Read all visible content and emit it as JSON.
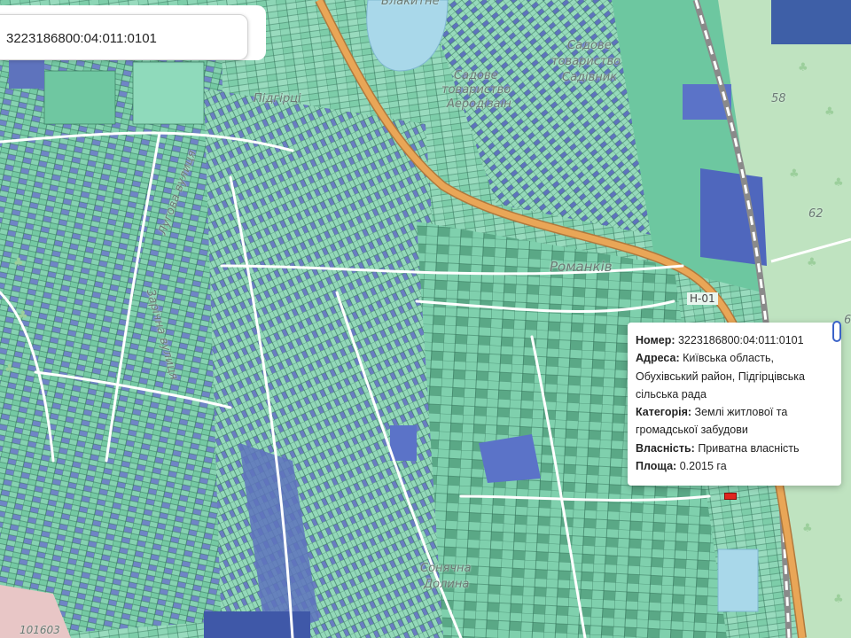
{
  "search": {
    "value": "3223186800:04:011:0101"
  },
  "map_labels": {
    "lake": "Блакитне",
    "garden_1": "Садове",
    "garden_2": "товариство",
    "garden_3": "Садівник",
    "garden_left_1": "Садове",
    "garden_left_2": "товариство",
    "garden_left_3": "Аеродізаін",
    "village": "Романків",
    "village_top": "Підгірці",
    "road_h01": "Н-01",
    "street_1": "Лугова вулиця",
    "street_2": "Зарічна вулиця",
    "sunny_1": "Сонячна",
    "sunny_2": "Долина",
    "num_58": "58",
    "num_62": "62",
    "num_6": "6",
    "bottom_code": "101603"
  },
  "popup": {
    "number_label": "Номер:",
    "number_value": "3223186800:04:011:0101",
    "address_label": "Адреса:",
    "address_value": "Київська область, Обухівський район, Підгірцівська сільська рада",
    "category_label": "Категорія:",
    "category_value": "Землі житлової та громадської забудови",
    "ownership_label": "Власність:",
    "ownership_value": "Приватна власність",
    "area_label": "Площа:",
    "area_value": "0.2015 га",
    "close_glyph": "×"
  },
  "colors": {
    "parcel_green": "#7fd0ad",
    "parcel_green_dark": "#5cb88e",
    "parcel_blue": "#6d7fc4",
    "road_orange": "#e9a657",
    "water": "#a9d8ea",
    "forest": "#c9e7c1",
    "highlight": "#e0261f"
  }
}
